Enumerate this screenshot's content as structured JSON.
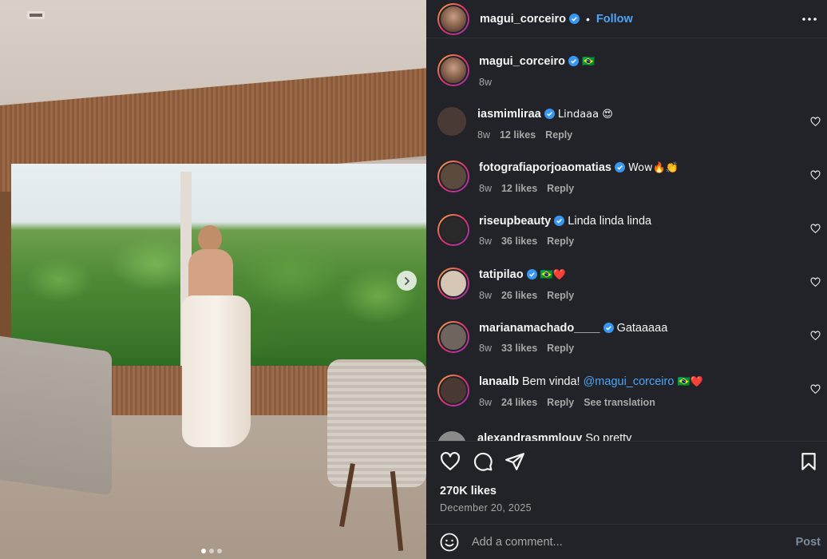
{
  "post": {
    "author": "magui_corceiro",
    "follow_label": "Follow",
    "dot": "•",
    "caption_flag": "🇧🇷",
    "caption_age": "8w",
    "likes": "270K likes",
    "date": "December 20, 2025",
    "carousel": {
      "slides": 3,
      "active": 1
    }
  },
  "comments": [
    {
      "user": "iasmimliraa",
      "text": "Lindaaa 😍",
      "age": "8w",
      "likes": "12 likes",
      "reply": "Reply",
      "avatar_color": "#4a3a35"
    },
    {
      "user": "fotografiaporjoaomatias",
      "text": "Wow🔥👏",
      "age": "8w",
      "likes": "12 likes",
      "reply": "Reply",
      "avatar_color": "#5b4a3e"
    },
    {
      "user": "riseupbeauty",
      "text": "Linda linda linda",
      "age": "8w",
      "likes": "36 likes",
      "reply": "Reply",
      "avatar_color": "#2a2a2a"
    },
    {
      "user": "tatipilao",
      "text": "🇧🇷❤️",
      "age": "8w",
      "likes": "26 likes",
      "reply": "Reply",
      "avatar_color": "#d6c6b6"
    },
    {
      "user": "marianamachado____",
      "text": "Gataaaaa",
      "age": "8w",
      "likes": "33 likes",
      "reply": "Reply",
      "avatar_color": "#6f655e"
    },
    {
      "user": "lanaalb",
      "text_pre": "Bem vinda!",
      "mention": "@magui_corceiro",
      "text_post": "🇧🇷❤️",
      "age": "8w",
      "likes": "24 likes",
      "reply": "Reply",
      "translate": "See translation",
      "avatar_color": "#4a3933"
    },
    {
      "user": "alexandrasmmlouy",
      "text": "So pretty",
      "avatar_color": "#8a8a8a"
    }
  ],
  "composer": {
    "placeholder": "Add a comment...",
    "post_label": "Post"
  },
  "icons": {
    "more": "more-dots-icon",
    "heart": "heart-icon",
    "comment": "comment-icon",
    "share": "share-icon",
    "save": "bookmark-icon",
    "emoji": "emoji-icon",
    "next": "chevron-right-icon",
    "verified": "verified-badge-icon"
  },
  "colors": {
    "panel_bg": "#212328",
    "link": "#4ea4f6",
    "muted": "#a8a8a8",
    "verified": "#3897f0"
  }
}
